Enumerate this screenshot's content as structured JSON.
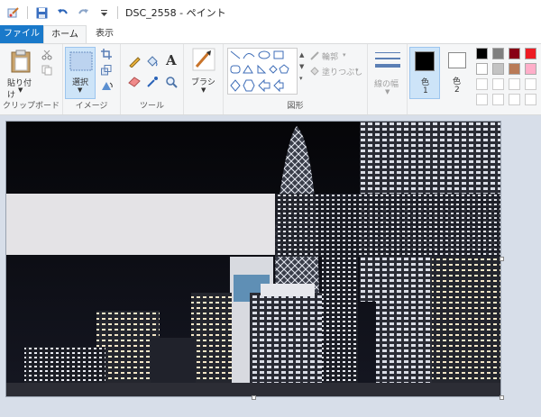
{
  "window": {
    "title": "DSC_2558 - ペイント"
  },
  "tabs": {
    "file": "ファイル",
    "home": "ホーム",
    "view": "表示"
  },
  "clipboard": {
    "paste": "貼り付け",
    "group": "クリップボード"
  },
  "image": {
    "select": "選択",
    "group": "イメージ"
  },
  "tools": {
    "text_glyph": "A",
    "group": "ツール"
  },
  "brush": {
    "label": "ブラシ"
  },
  "shapes": {
    "outline": "輪郭",
    "fill": "塗りつぶし",
    "group": "図形"
  },
  "size": {
    "label": "線の幅"
  },
  "colors": {
    "color1_label": "色",
    "color1_num": "1",
    "color2_label": "色",
    "color2_num": "2",
    "color1_value": "#000000",
    "color2_value": "#ffffff",
    "palette_row1": [
      "#000000",
      "#7f7f7f",
      "#880015",
      "#ed1c24"
    ],
    "palette_row2": [
      "#ffffff",
      "#c3c3c3",
      "#b97a57",
      "#ffaec9"
    ]
  },
  "canvas": {
    "image_name": "DSC_2558"
  }
}
